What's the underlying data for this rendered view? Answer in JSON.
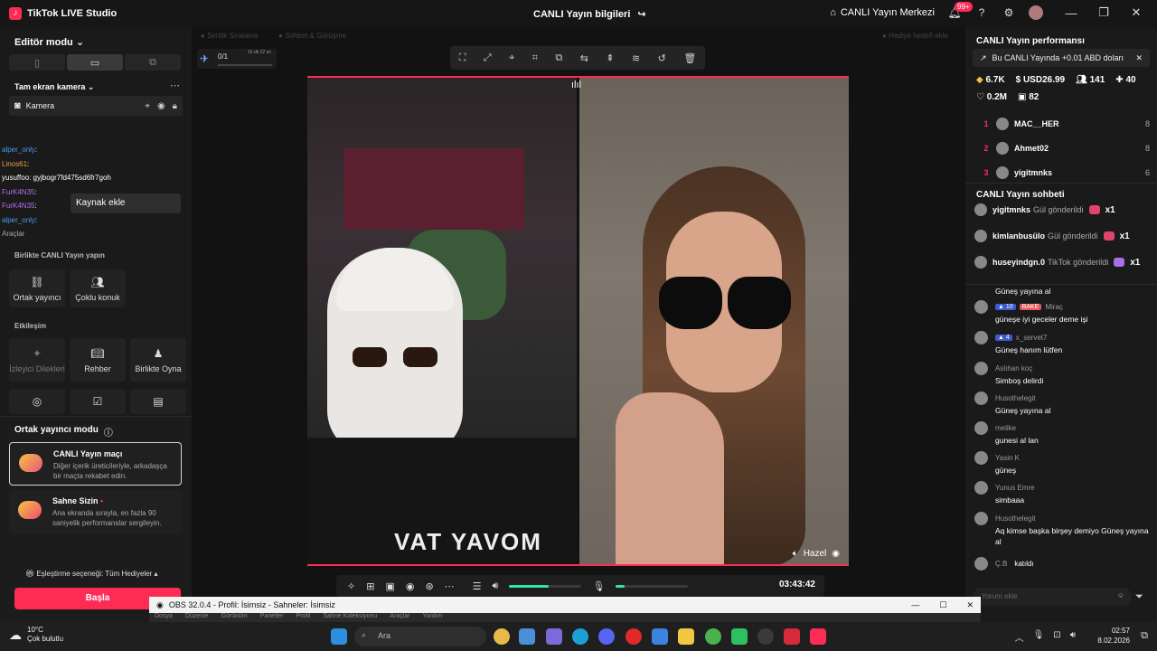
{
  "titlebar": {
    "app_name": "TikTok LIVE Studio",
    "center_title": "CANLI Yayın bilgileri",
    "live_center": "CANLI Yayın Merkezi",
    "notification_count": "99+"
  },
  "left": {
    "editor_mode": "Editör modu",
    "fullscreen_camera": "Tam ekran kamera",
    "camera_source": "Kamera",
    "tooltip": "Kaynak ekle",
    "chat_overlay": [
      {
        "user": "alper_only",
        "text": ":",
        "color": "#4a9cf0"
      },
      {
        "user": "Linos61",
        "text": ":",
        "color": "#f0a040"
      },
      {
        "user": "yusuffoo",
        "text": ": gyjbogr7fd475sd6fr7goh",
        "color": "#ffffff"
      },
      {
        "user": "FurK4N35",
        "text": ":",
        "color": "#b070f0"
      },
      {
        "user": "FurK4N35",
        "text": ":",
        "color": "#b070f0"
      },
      {
        "user": "alper_only",
        "text": ":",
        "color": "#4a9cf0"
      },
      {
        "user": "Araçlar",
        "text": "",
        "color": "#aaaaaa"
      }
    ],
    "collab_title": "Birlikte CANLI Yayın yapın",
    "collab_buttons": [
      "Ortak yayıncı",
      "Çoklu konuk"
    ],
    "interaction_title": "Etkileşim",
    "interaction_buttons": [
      "İzleyici Dilekleri",
      "Rehber",
      "Birlikte Oyna"
    ],
    "cohost_mode_title": "Ortak yayıncı modu",
    "cards": [
      {
        "title": "CANLI Yayın maçı",
        "desc": "Diğer içerik üreticileriyle, arkadaşça bir maçta rekabet edin."
      },
      {
        "title": "Sahne Sizin",
        "desc": "Ana ekranda sırayla, en fazla 90 saniyelik performanslar sergileyin."
      }
    ],
    "match_option": "Eşleştirme seçeneği: Tüm Hediyeler",
    "start_button": "Başla"
  },
  "center": {
    "tab1": "Sertlik Sıralama",
    "tab2": "Sohbet & Görüşme",
    "gift_goal": "Hediye hedefi ekle",
    "goal_count": "0/1",
    "goal_timer": "16 dk 22 sn",
    "host_name": "Hazel",
    "timer": "03:43:42",
    "mic_level": 0.12,
    "volume_level": 0.55,
    "left_video_text": "VAT YAVOM"
  },
  "right": {
    "performance_title": "CANLI Yayın performansı",
    "banner": "Bu CANLI Yayında +0.01 ABD doları",
    "stats": {
      "coins": "6.7K",
      "usd": "USD26.99",
      "viewers": "141",
      "new_followers": "40",
      "likes": "0.2M",
      "shares": "82"
    },
    "ranking": [
      {
        "rank": "1",
        "name": "MAC__HER",
        "score": "8"
      },
      {
        "rank": "2",
        "name": "Ahmet02",
        "score": "8"
      },
      {
        "rank": "3",
        "name": "yigitmnks",
        "score": "6"
      }
    ],
    "chat_title": "CANLI Yayın sohbeti",
    "gifts": [
      {
        "user": "yigitmnks",
        "action": "Gül gönderildi",
        "count": "x1"
      },
      {
        "user": "kimlanbusülo",
        "action": "Gül gönderildi",
        "count": "x1"
      },
      {
        "user": "huseyindgn.0",
        "action": "TikTok gönderildi",
        "count": "x1"
      }
    ],
    "messages": [
      {
        "user": "",
        "text": "Güneş yayına al"
      },
      {
        "user": "Miraç",
        "level": "10",
        "tag": "BAKE",
        "text": "güneşe iyi geceler deme işi"
      },
      {
        "user": "x_servet7",
        "level": "4",
        "text": "Güneş hanım lütfen"
      },
      {
        "user": "Aslıhan koç",
        "text": "Simboş delirdi"
      },
      {
        "user": "Husothelegit",
        "text": "Güneş yayına al"
      },
      {
        "user": "melike",
        "text": "gunesi al lan"
      },
      {
        "user": "Yasin K",
        "text": "güneş"
      },
      {
        "user": "Yunus Emre",
        "text": "simbaaa"
      },
      {
        "user": "Husothelegit",
        "text": "Aq kimse başka birşey demiyo Güneş yayına al"
      },
      {
        "user": "Ç.B",
        "text": "katıldı"
      }
    ],
    "comment_placeholder": "Yorum ekle"
  },
  "obs": {
    "title": "OBS 32.0.4 - Profil: İsimsiz - Sahneler: İsimsiz",
    "menu": [
      "Dosya",
      "Düzenle",
      "Görünüm",
      "Paneller",
      "Profil",
      "Sahne Koleksiyonu",
      "Araçlar",
      "Yardım"
    ]
  },
  "taskbar": {
    "temperature": "10°C",
    "weather": "Çok bulutlu",
    "search": "Ara",
    "time": "02:57",
    "date": "8.02.2026"
  }
}
